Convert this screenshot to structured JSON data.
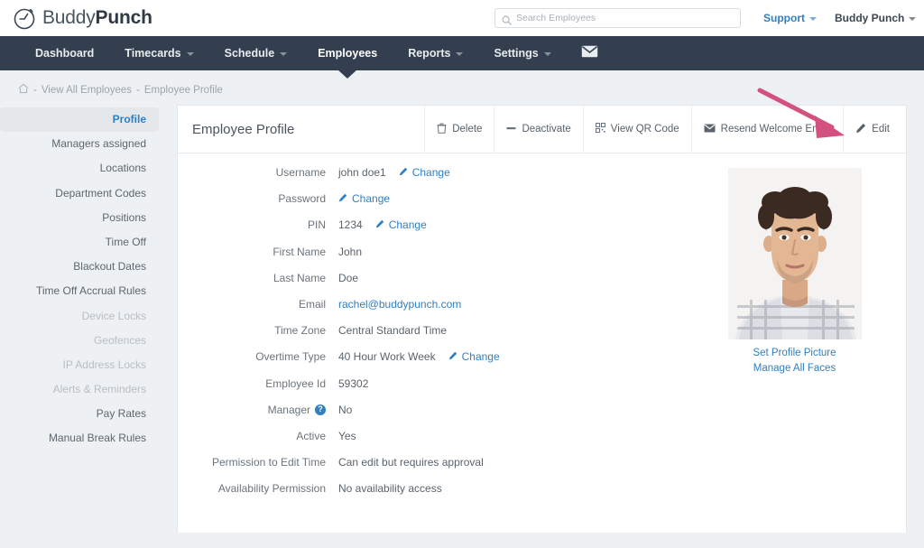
{
  "brand": {
    "name_thin": "Buddy",
    "name_bold": "Punch",
    "logo_icon": "clock-icon"
  },
  "colors": {
    "nav_bg": "#333f4f",
    "link_blue": "#2f7fc1",
    "arrow_pink": "#d4507e",
    "page_bg": "#eef1f3"
  },
  "topbar": {
    "search": {
      "placeholder": "Search Employees",
      "value": "",
      "icon": "search-icon"
    },
    "support_label": "Support",
    "account_label": "Buddy Punch"
  },
  "nav": {
    "items": [
      {
        "label": "Dashboard",
        "has_caret": false,
        "active": false
      },
      {
        "label": "Timecards",
        "has_caret": true,
        "active": false
      },
      {
        "label": "Schedule",
        "has_caret": true,
        "active": false
      },
      {
        "label": "Employees",
        "has_caret": false,
        "active": true
      },
      {
        "label": "Reports",
        "has_caret": true,
        "active": false
      },
      {
        "label": "Settings",
        "has_caret": true,
        "active": false
      }
    ],
    "mail_icon": "envelope-icon"
  },
  "breadcrumb": {
    "home_icon": "home-icon",
    "sep1": "-",
    "link1": "View All Employees",
    "sep2": "-",
    "current": "Employee Profile"
  },
  "sidebar": {
    "items": [
      {
        "label": "Profile",
        "active": true,
        "muted": false
      },
      {
        "label": "Managers assigned",
        "active": false,
        "muted": false
      },
      {
        "label": "Locations",
        "active": false,
        "muted": false
      },
      {
        "label": "Department Codes",
        "active": false,
        "muted": false
      },
      {
        "label": "Positions",
        "active": false,
        "muted": false
      },
      {
        "label": "Time Off",
        "active": false,
        "muted": false
      },
      {
        "label": "Blackout Dates",
        "active": false,
        "muted": false
      },
      {
        "label": "Time Off Accrual Rules",
        "active": false,
        "muted": false
      },
      {
        "label": "Device Locks",
        "active": false,
        "muted": true
      },
      {
        "label": "Geofences",
        "active": false,
        "muted": true
      },
      {
        "label": "IP Address Locks",
        "active": false,
        "muted": true
      },
      {
        "label": "Alerts & Reminders",
        "active": false,
        "muted": true
      },
      {
        "label": "Pay Rates",
        "active": false,
        "muted": false
      },
      {
        "label": "Manual Break Rules",
        "active": false,
        "muted": false
      }
    ]
  },
  "card": {
    "title": "Employee Profile",
    "toolbar": [
      {
        "label": "Delete",
        "icon": "trash-icon"
      },
      {
        "label": "Deactivate",
        "icon": "minus-icon"
      },
      {
        "label": "View QR Code",
        "icon": "qr-code-icon"
      },
      {
        "label": "Resend Welcome Email",
        "icon": "envelope-icon"
      },
      {
        "label": "Edit",
        "icon": "pencil-icon"
      }
    ],
    "fields": [
      {
        "label": "Username",
        "value": "john doe1",
        "change": "Change",
        "type": "text"
      },
      {
        "label": "Password",
        "value": "",
        "change": "Change",
        "type": "text"
      },
      {
        "label": "PIN",
        "value": "1234",
        "change": "Change",
        "type": "text"
      },
      {
        "label": "First Name",
        "value": "John",
        "change": "",
        "type": "text"
      },
      {
        "label": "Last Name",
        "value": "Doe",
        "change": "",
        "type": "text"
      },
      {
        "label": "Email",
        "value": "rachel@buddypunch.com",
        "change": "",
        "type": "link"
      },
      {
        "label": "Time Zone",
        "value": "Central Standard Time",
        "change": "",
        "type": "text"
      },
      {
        "label": "Overtime Type",
        "value": "40 Hour Work Week",
        "change": "Change",
        "type": "text"
      },
      {
        "label": "Employee Id",
        "value": "59302",
        "change": "",
        "type": "text"
      },
      {
        "label": "Manager",
        "value": "No",
        "change": "",
        "type": "text",
        "help": "?"
      },
      {
        "label": "Active",
        "value": "Yes",
        "change": "",
        "type": "text"
      },
      {
        "label": "Permission to Edit Time",
        "value": "Can edit but requires approval",
        "change": "",
        "type": "text"
      },
      {
        "label": "Availability Permission",
        "value": "No availability access",
        "change": "",
        "type": "text"
      }
    ],
    "photo": {
      "alt": "employee-profile-photo",
      "set_picture_label": "Set Profile Picture",
      "manage_faces_label": "Manage All Faces"
    }
  },
  "annotation": {
    "arrow_target": "Edit",
    "arrow_color": "#d4507e"
  }
}
